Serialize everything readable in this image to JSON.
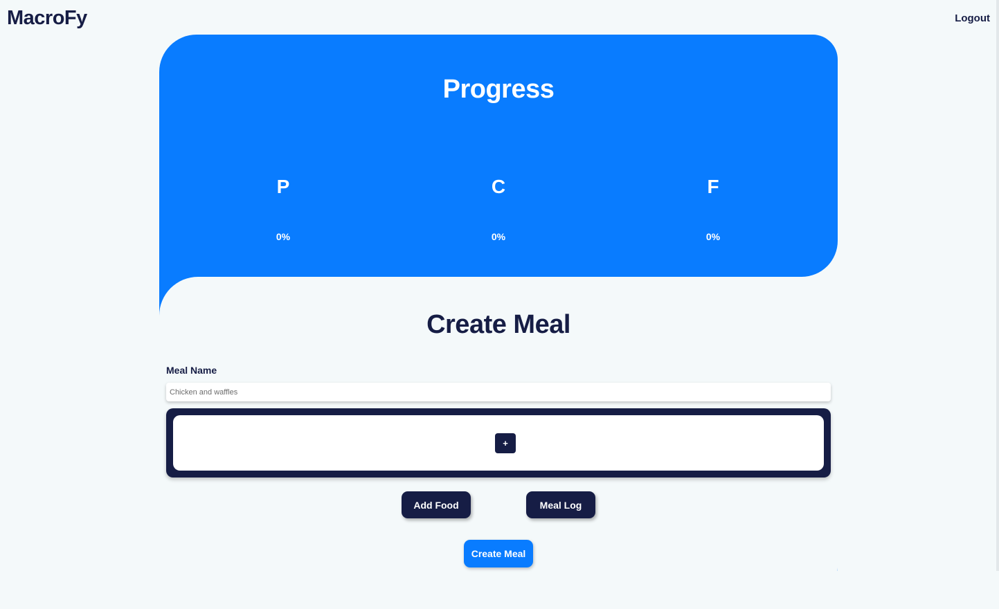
{
  "header": {
    "brand": "MacroFy",
    "logout_label": "Logout"
  },
  "progress": {
    "title": "Progress",
    "macros": [
      {
        "letter": "P",
        "value": "0%"
      },
      {
        "letter": "C",
        "value": "0%"
      },
      {
        "letter": "F",
        "value": "0%"
      }
    ]
  },
  "create_meal": {
    "title": "Create Meal",
    "meal_name_label": "Meal Name",
    "meal_name_placeholder": "Chicken and waffles",
    "meal_name_value": "",
    "add_item_label": "+",
    "add_food_label": "Add Food",
    "meal_log_label": "Meal Log",
    "create_meal_label": "Create Meal"
  },
  "colors": {
    "primary_blue": "#097cff",
    "navy": "#161d45",
    "background": "#f4f9fa"
  }
}
